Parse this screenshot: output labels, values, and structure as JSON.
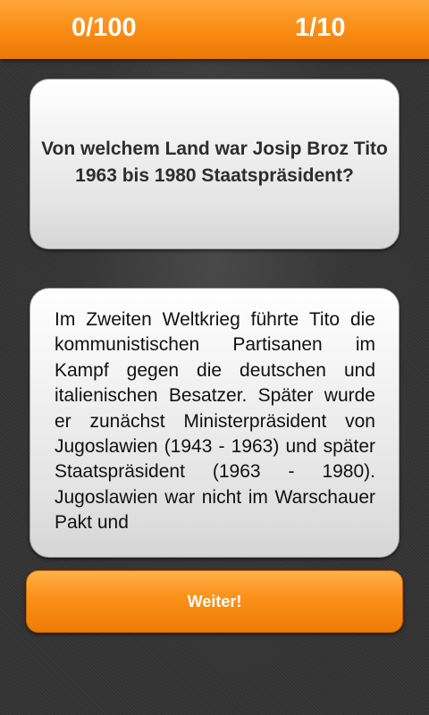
{
  "header": {
    "score": "0/100",
    "progress": "1/10"
  },
  "question": {
    "text": "Von welchem Land war Josip Broz Tito 1963 bis 1980 Staatspräsident?"
  },
  "info": {
    "text": "Im Zweiten Weltkrieg führte Tito die kommunistischen Partisanen im Kampf gegen die deutschen und italienischen Besatzer. Später wurde er zunächst Ministerpräsident von Jugoslawien (1943 - 1963) und später Staatspräsident (1963 - 1980). Jugoslawien war nicht im Warschauer Pakt und"
  },
  "actions": {
    "next_label": "Weiter!"
  },
  "colors": {
    "accent": "#f98b12",
    "background": "#333333"
  }
}
